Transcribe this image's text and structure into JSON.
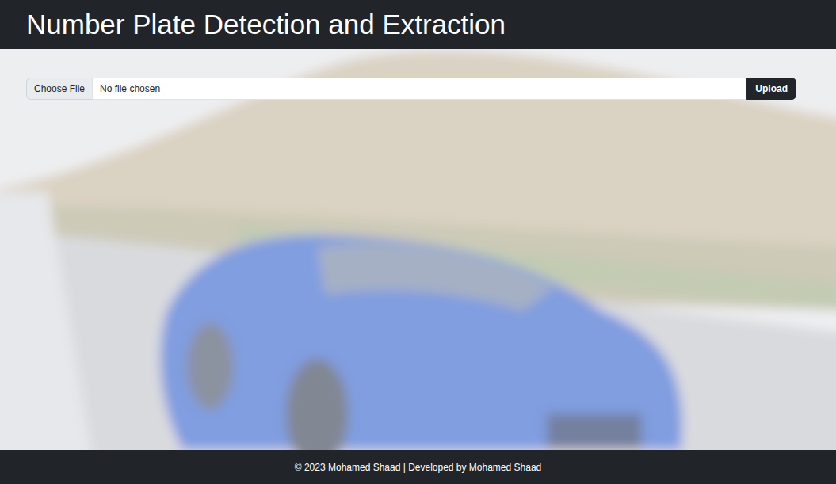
{
  "header": {
    "title": "Number Plate Detection and Extraction"
  },
  "upload": {
    "choose_button": "Choose File",
    "file_status": "No file chosen",
    "submit_button": "Upload"
  },
  "footer": {
    "text": "© 2023 Mohamed Shaad | Developed by Mohamed Shaad"
  }
}
